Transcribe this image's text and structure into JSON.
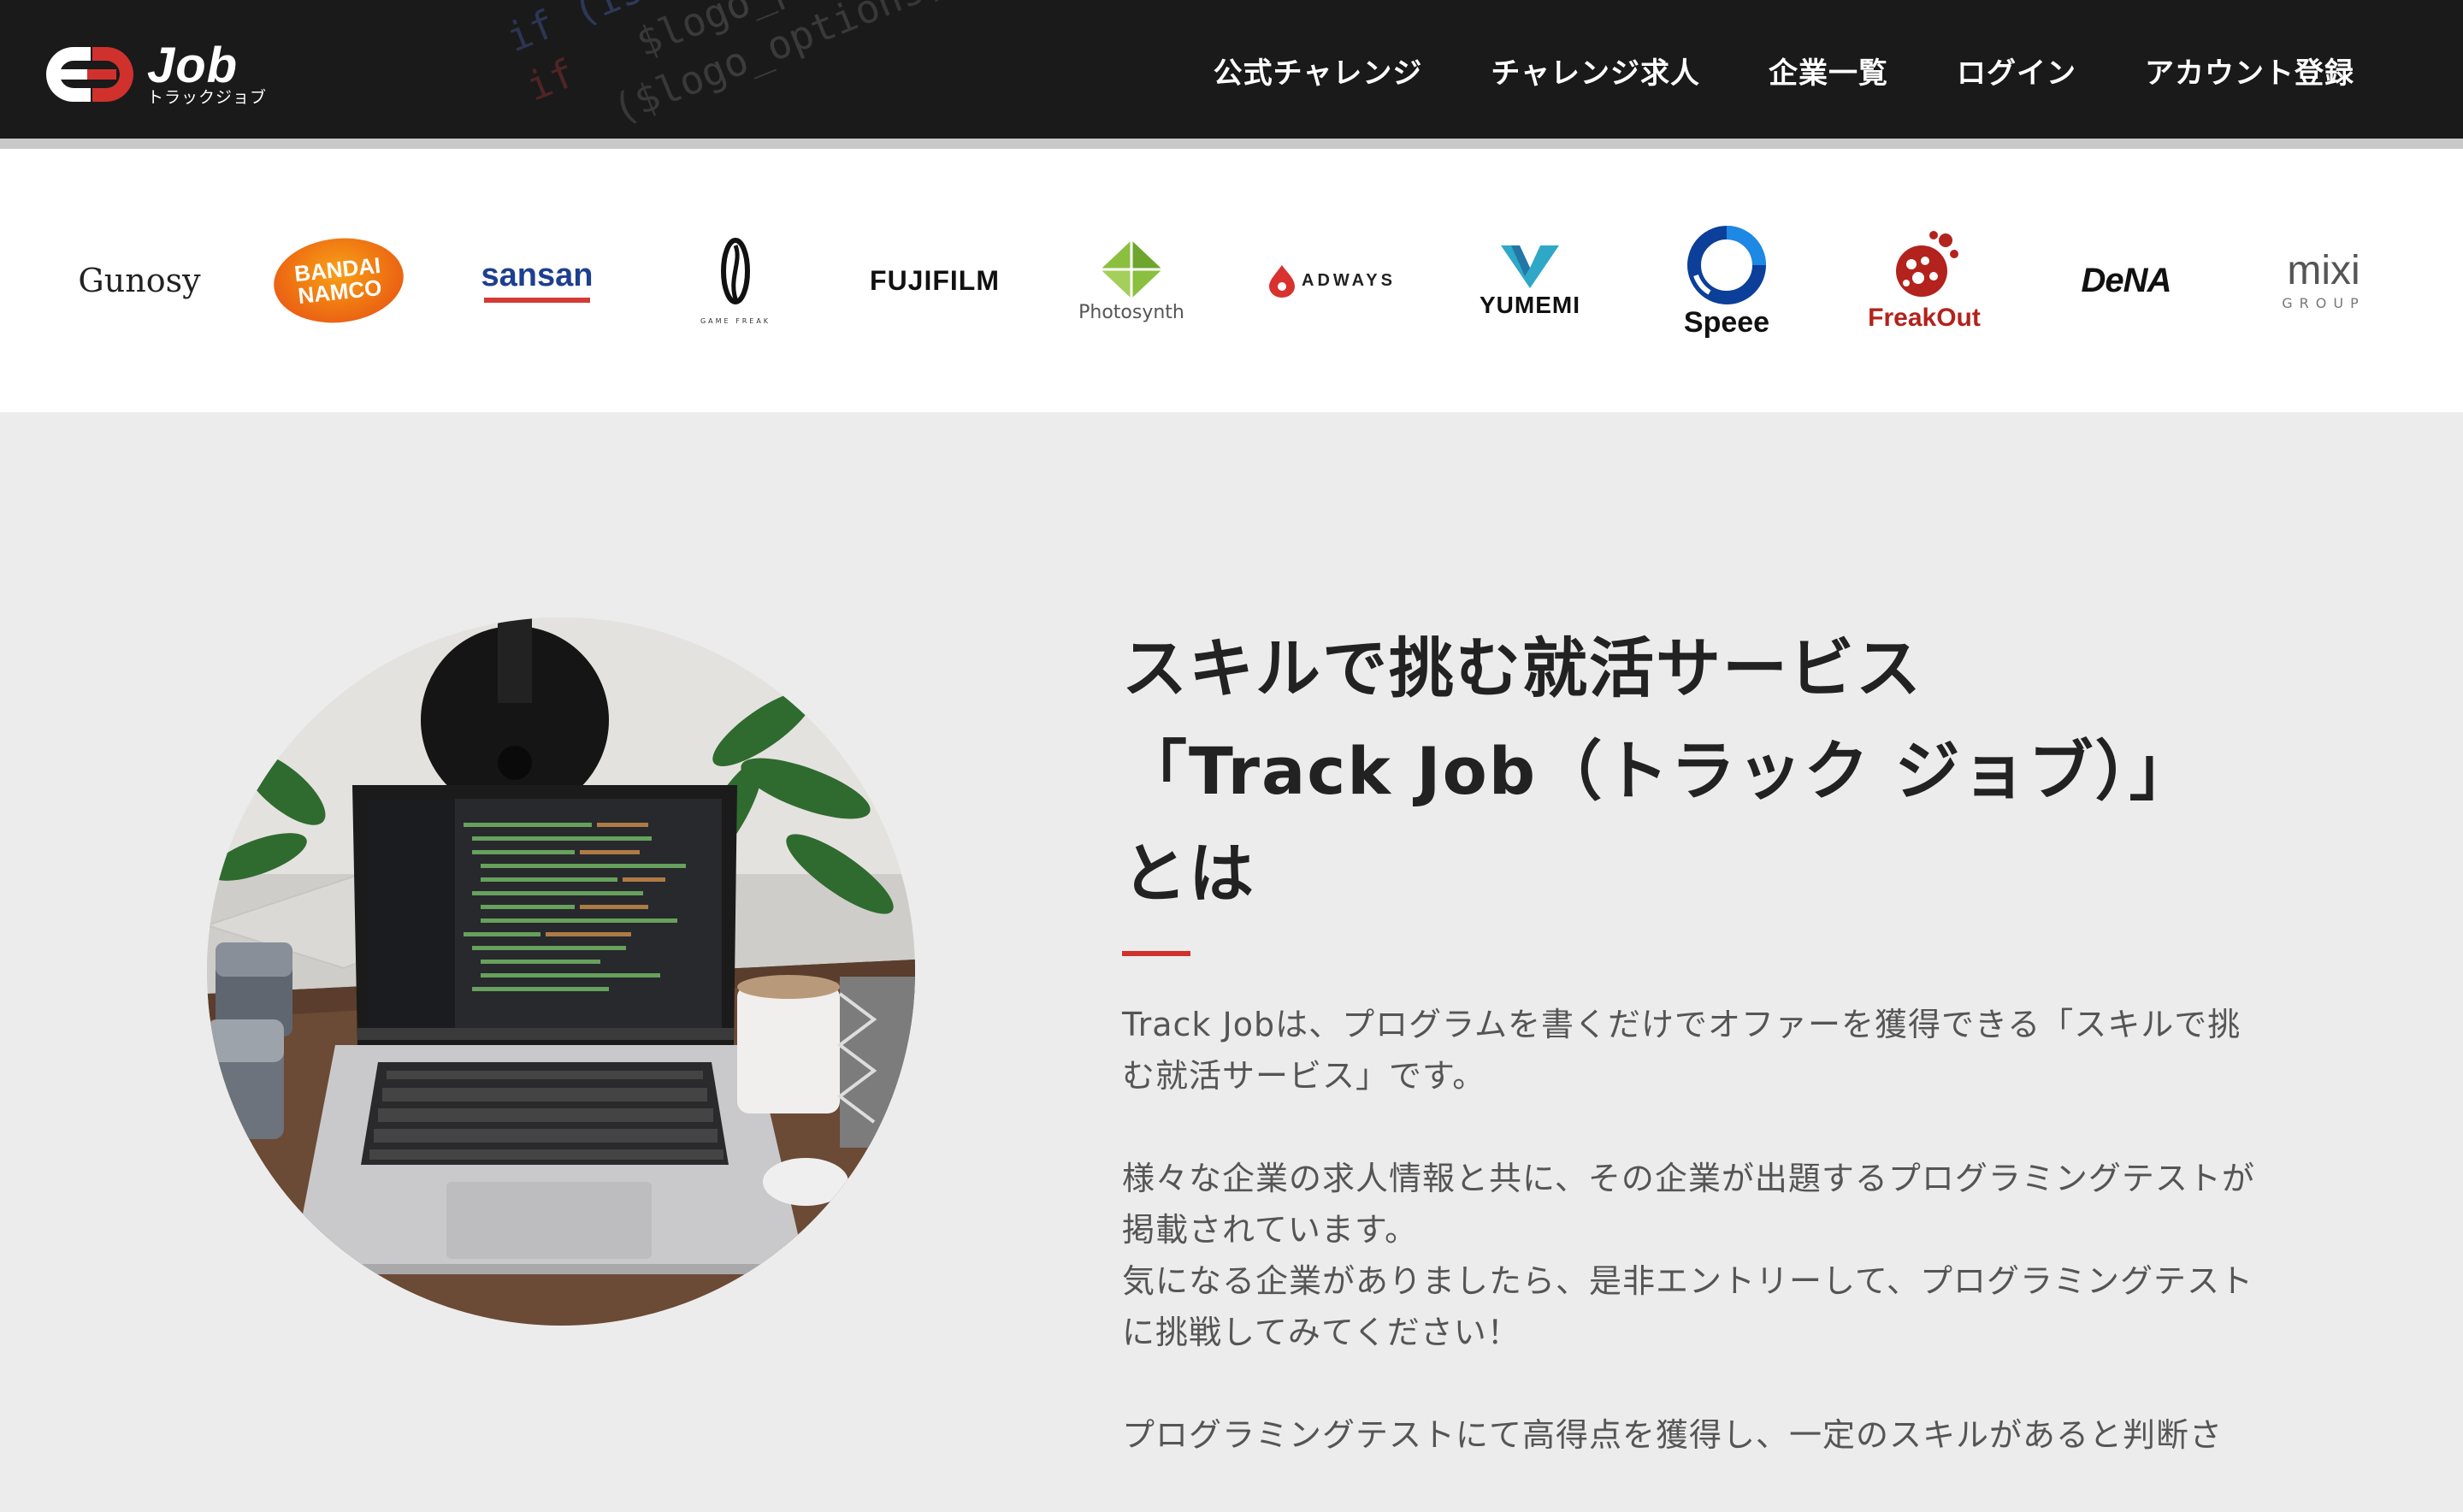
{
  "header": {
    "logo_text": "Job",
    "logo_subtext": "トラックジョブ",
    "brand_color": "#d0312d",
    "nav": [
      {
        "label": "公式チャレンジ"
      },
      {
        "label": "チャレンジ求人"
      },
      {
        "label": "企業一覧"
      },
      {
        "label": "ログイン"
      },
      {
        "label": "アカウント登録"
      }
    ]
  },
  "companies": [
    {
      "name": "Gunosy"
    },
    {
      "name": "BANDAI NAMCO",
      "line1": "BANDAI",
      "line2": "NAMCO"
    },
    {
      "name": "sansan"
    },
    {
      "name": "GAME FREAK",
      "caption": "GAME FREAK"
    },
    {
      "name": "FUJIFILM"
    },
    {
      "name": "Photosynth"
    },
    {
      "name": "ADWAYS"
    },
    {
      "name": "YUMEMI"
    },
    {
      "name": "Speee"
    },
    {
      "name": "FreakOut"
    },
    {
      "name": "DeNA"
    },
    {
      "name": "mixi GROUP",
      "line1": "mixi",
      "line2": "GROUP"
    }
  ],
  "intro": {
    "title_lines": [
      "スキルで挑む就活サービス",
      "「Track Job（トラック ジョブ）」",
      "とは"
    ],
    "accent_color": "#d0312d",
    "paragraphs": [
      "Track Jobは、プログラムを書くだけでオファーを獲得できる「スキルで挑む就活サービス」です。",
      "様々な企業の求人情報と共に、その企業が出題するプログラミングテストが掲載されています。",
      "気になる企業がありましたら、是非エントリーして、プログラミングテストに挑戦してみてください！",
      "プログラミングテストにて高得点を獲得し、一定のスキルがあると判断さ"
    ]
  }
}
